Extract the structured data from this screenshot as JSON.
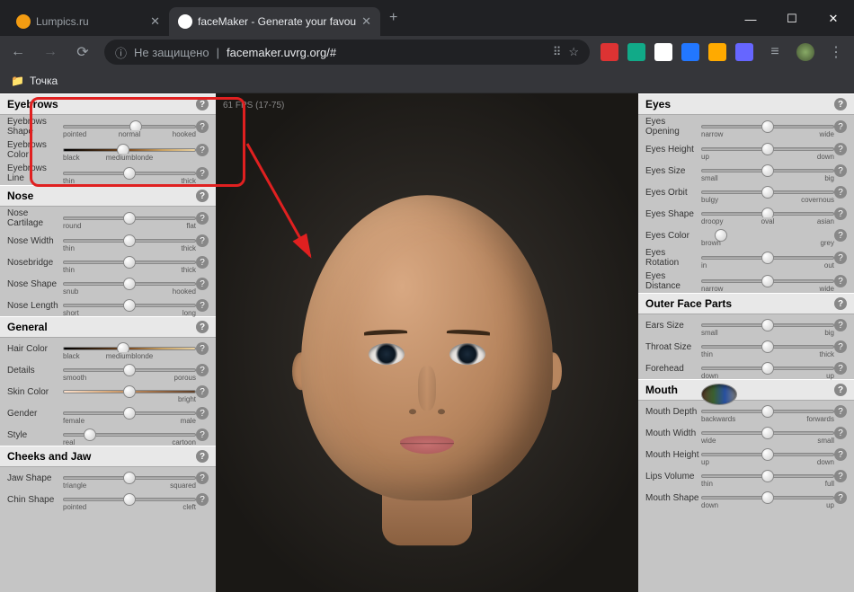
{
  "browser": {
    "tabs": [
      {
        "title": "Lumpics.ru",
        "favicon": "#f39c12",
        "active": false
      },
      {
        "title": "faceMaker - Generate your favou",
        "favicon": "#fff",
        "active": true
      }
    ],
    "newtab": "+",
    "win": {
      "min": "—",
      "max": "☐",
      "close": "✕"
    },
    "nav": {
      "back": "←",
      "fwd": "→",
      "reload": "⟳"
    },
    "address": {
      "secure_icon": "ⓘ",
      "secure_text": "Не защищено",
      "sep": "|",
      "url": "facemaker.uvrg.org/#",
      "translate": "⠿",
      "star": "☆"
    },
    "ext_colors": [
      "#d33",
      "#1a8",
      "#fff",
      "#27f",
      "#fa0",
      "#66f"
    ],
    "menulines": "≡",
    "bookmark": {
      "icon": "📁",
      "label": "Точка"
    }
  },
  "fps": "61 FPS (17-75)",
  "left_panel": [
    {
      "title": "Eyebrows",
      "rows": [
        {
          "label": "Eyebrows Shape",
          "left": "pointed",
          "mid": "normal",
          "right": "hooked",
          "pos": 55
        },
        {
          "label": "Eyebrows Color",
          "left": "black",
          "mid": "mediumblonde",
          "right": "",
          "pos": 45,
          "trackClass": "hair"
        },
        {
          "label": "Eyebrows Line",
          "left": "thin",
          "right": "thick",
          "pos": 50
        }
      ]
    },
    {
      "title": "Nose",
      "rows": [
        {
          "label": "Nose Cartilage",
          "left": "round",
          "right": "flat",
          "pos": 50
        },
        {
          "label": "Nose Width",
          "left": "thin",
          "right": "thick",
          "pos": 50
        },
        {
          "label": "Nosebridge",
          "left": "thin",
          "right": "thick",
          "pos": 50
        },
        {
          "label": "Nose Shape",
          "left": "snub",
          "right": "hooked",
          "pos": 50
        },
        {
          "label": "Nose Length",
          "left": "short",
          "right": "long",
          "pos": 50
        }
      ]
    },
    {
      "title": "General",
      "rows": [
        {
          "label": "Hair Color",
          "left": "black",
          "mid": "mediumblonde",
          "right": "",
          "pos": 45,
          "trackClass": "hair"
        },
        {
          "label": "Details",
          "left": "smooth",
          "right": "porous",
          "pos": 50
        },
        {
          "label": "Skin Color",
          "left": "",
          "right": "bright",
          "pos": 50,
          "trackClass": "skin"
        },
        {
          "label": "Gender",
          "left": "female",
          "right": "male",
          "pos": 50
        },
        {
          "label": "Style",
          "left": "real",
          "right": "cartoon",
          "pos": 20
        }
      ]
    },
    {
      "title": "Cheeks and Jaw",
      "rows": [
        {
          "label": "Jaw Shape",
          "left": "triangle",
          "right": "squared",
          "pos": 50
        },
        {
          "label": "Chin Shape",
          "left": "pointed",
          "right": "cleft",
          "pos": 50
        }
      ]
    }
  ],
  "right_panel": [
    {
      "title": "Eyes",
      "rows": [
        {
          "label": "Eyes Opening",
          "left": "narrow",
          "right": "wide",
          "pos": 50
        },
        {
          "label": "Eyes Height",
          "left": "up",
          "right": "down",
          "pos": 50
        },
        {
          "label": "Eyes Size",
          "left": "small",
          "right": "big",
          "pos": 50
        },
        {
          "label": "Eyes Orbit",
          "left": "bulgy",
          "right": "covernous",
          "pos": 50
        },
        {
          "label": "Eyes Shape",
          "left": "droopy",
          "mid": "oval",
          "right": "asian",
          "pos": 50
        },
        {
          "label": "Eyes Color",
          "left": "brown",
          "right": "grey",
          "pos": 15,
          "trackClass": "eye"
        },
        {
          "label": "Eyes Rotation",
          "left": "in",
          "right": "out",
          "pos": 50
        },
        {
          "label": "Eyes Distance",
          "left": "narrow",
          "right": "wide",
          "pos": 50
        }
      ]
    },
    {
      "title": "Outer Face Parts",
      "rows": [
        {
          "label": "Ears Size",
          "left": "small",
          "right": "big",
          "pos": 50
        },
        {
          "label": "Throat Size",
          "left": "thin",
          "right": "thick",
          "pos": 50
        },
        {
          "label": "Forehead",
          "left": "down",
          "right": "up",
          "pos": 50
        }
      ]
    },
    {
      "title": "Mouth",
      "rows": [
        {
          "label": "Mouth Depth",
          "left": "backwards",
          "right": "forwards",
          "pos": 50
        },
        {
          "label": "Mouth Width",
          "left": "wide",
          "right": "small",
          "pos": 50
        },
        {
          "label": "Mouth Height",
          "left": "up",
          "right": "down",
          "pos": 50
        },
        {
          "label": "Lips Volume",
          "left": "thin",
          "right": "full",
          "pos": 50
        },
        {
          "label": "Mouth Shape",
          "left": "down",
          "right": "up",
          "pos": 50
        }
      ]
    }
  ],
  "help": "?"
}
